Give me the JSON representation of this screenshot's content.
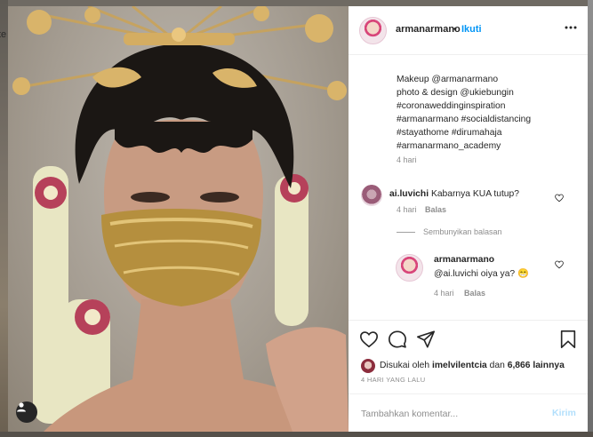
{
  "background": {
    "left_fragment": "te"
  },
  "post": {
    "username": "armanarmano",
    "separator": "•",
    "follow_label": "Ikuti",
    "caption_lines": [
      "Makeup @armanarmano",
      "photo & design @ukiebungin",
      "#coronaweddinginspiration",
      "#armanarmano #socialdistancing",
      "#stayathome #dirumahaja",
      "#armanarmano_academy"
    ],
    "caption_time": "4 hari"
  },
  "comments": {
    "first": {
      "username": "ai.luvichi",
      "text": "Kabarnya KUA tutup?",
      "time": "4 hari",
      "reply_label": "Balas"
    },
    "hide_replies_label": "Sembunyikan balasan",
    "reply": {
      "username": "armanarmano",
      "text": "@ai.luvichi oiya ya? 😁",
      "time": "4 hari",
      "reply_label": "Balas"
    }
  },
  "likes": {
    "prefix": "Disukai oleh",
    "user": "imelvilentcia",
    "joiner": "dan",
    "count": "6,866 lainnya"
  },
  "date_label": "4 HARI YANG LALU",
  "comment_box": {
    "placeholder": "Tambahkan komentar...",
    "send_label": "Kirim"
  },
  "colors": {
    "accent": "#0095f6",
    "send_disabled": "#b2dffc",
    "muted": "#8e8e8e",
    "text": "#262626"
  },
  "icons": [
    "heart-icon",
    "comment-icon",
    "share-icon",
    "bookmark-icon",
    "more-icon",
    "user-tag-icon"
  ]
}
